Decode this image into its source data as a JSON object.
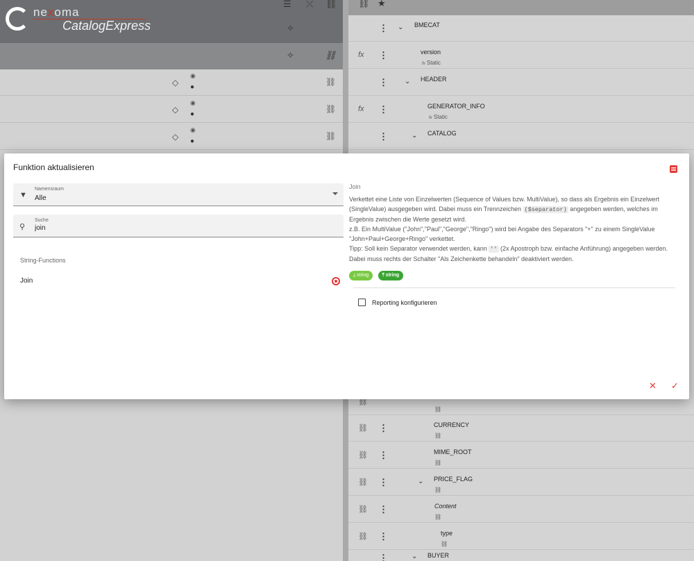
{
  "app": {
    "brand": {
      "name_pre": "ne",
      "name_x": "x",
      "name_post": "oma",
      "product": "CatalogExpress"
    }
  },
  "left_panel": {
    "rows": [
      {
        "id": 1
      },
      {
        "id": 2
      },
      {
        "id": 3
      }
    ]
  },
  "right_panel": {
    "rows": [
      {
        "name": "BMECAT",
        "sub": "",
        "prefix": "",
        "chevron": true
      },
      {
        "name": "version",
        "sub": "Static",
        "prefix": "fx",
        "chevron": false
      },
      {
        "name": "HEADER",
        "sub": "",
        "prefix": "",
        "chevron": true
      },
      {
        "name": "GENERATOR_INFO",
        "sub": "Static",
        "prefix": "fx",
        "chevron": false
      },
      {
        "name": "CATALOG",
        "sub": "",
        "prefix": "",
        "chevron": true
      },
      {
        "name": "CURRENCY",
        "sub": "",
        "prefix": "link",
        "chevron": false
      },
      {
        "name": "MIME_ROOT",
        "sub": "",
        "prefix": "link",
        "chevron": false
      },
      {
        "name": "PRICE_FLAG",
        "sub": "",
        "prefix": "link",
        "chevron": true
      },
      {
        "name": "Content",
        "sub": "",
        "prefix": "link",
        "chevron": false
      },
      {
        "name": "type",
        "sub": "",
        "prefix": "link",
        "chevron": false
      },
      {
        "name": "BUYER",
        "sub": "",
        "prefix": "",
        "chevron": true
      }
    ]
  },
  "modal": {
    "title": "Funktion aktualisieren",
    "namespace": {
      "label": "Namensraum",
      "value": "Alle"
    },
    "search": {
      "label": "Suche",
      "value": "join"
    },
    "group": "String-Functions",
    "function_item": {
      "label": "Join",
      "selected": true
    },
    "description": {
      "function_name": "Join",
      "text_1": "Verkettet eine Liste von Einzelwerten (Sequence of Values bzw. MultiValue), so dass als Ergebnis ein Einzelwert (SingleValue) ausgegeben wird. Dabei muss ein Trennzeichen",
      "code_1": "($separator)",
      "text_2": "angegeben werden, welches im Ergebnis zwischen die Werte gesetzt wird.",
      "example": "z.B. Ein MultiValue (\"John\",\"Paul\",\"George\",\"Ringo\") wird bei Angabe des Separators \"+\" zu einem SingleValue \"John+Paul+George+Ringo\" verkettet.",
      "tip_1": "Tipp: Soll kein Separator verwendet werden, kann",
      "code_2": "''",
      "tip_2": "(2x Apostroph bzw. einfache Anführung) angegeben werden. Dabei muss rechts der Schalter \"Als Zeichenkette behandeln\" deaktiviert werden.",
      "input_type": "string",
      "output_type": "string"
    },
    "reporting_label": "Reporting konfigurieren",
    "reporting_checked": false
  },
  "colors": {
    "accent": "#e53935",
    "badge_input": "#7ac943",
    "badge_output": "#3aa534"
  }
}
